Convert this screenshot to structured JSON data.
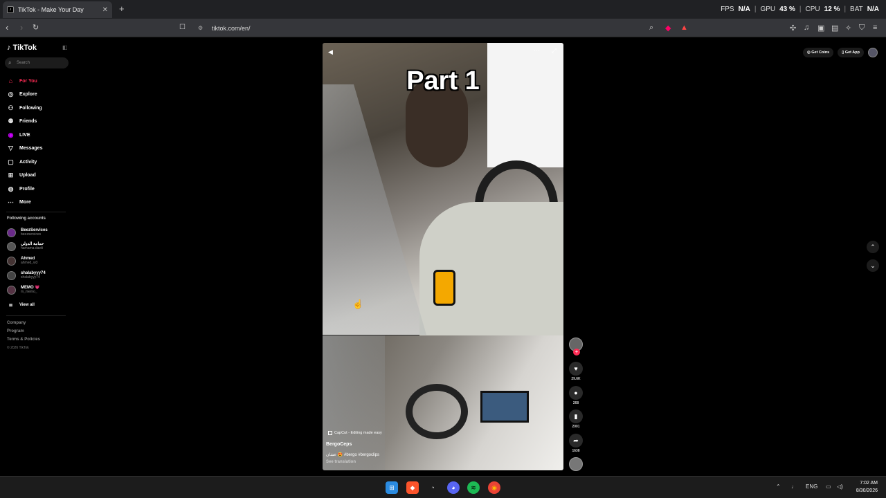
{
  "browser": {
    "tab_title": "TikTok - Make Your Day",
    "tab_close": "✕",
    "new_tab": "+",
    "url": "tiktok.com/en/",
    "perf": {
      "fps_label": "FPS",
      "fps_value": "N/A",
      "gpu_label": "GPU",
      "gpu_value": "43 %",
      "cpu_label": "CPU",
      "cpu_value": "12 %",
      "bat_label": "BAT",
      "bat_value": "N/A"
    }
  },
  "sidebar": {
    "logo": "TikTok",
    "search_placeholder": "Search",
    "nav": [
      {
        "label": "For You",
        "icon": "home-icon"
      },
      {
        "label": "Explore",
        "icon": "compass-icon"
      },
      {
        "label": "Following",
        "icon": "following-icon"
      },
      {
        "label": "Friends",
        "icon": "friends-icon"
      },
      {
        "label": "LIVE",
        "icon": "live-icon"
      },
      {
        "label": "Messages",
        "icon": "messages-icon"
      },
      {
        "label": "Activity",
        "icon": "activity-icon"
      },
      {
        "label": "Upload",
        "icon": "upload-icon"
      },
      {
        "label": "Profile",
        "icon": "profile-icon"
      },
      {
        "label": "More",
        "icon": "more-icon"
      }
    ],
    "following_title": "Following accounts",
    "accounts": [
      {
        "name": "BeezServices",
        "handle": "beezservices"
      },
      {
        "name": "حمامة الدولي",
        "handle": "hamama.dawli"
      },
      {
        "name": "Ahmed",
        "handle": "ahmed_w3"
      },
      {
        "name": "shalabyyy74",
        "handle": "shalabyyy74"
      },
      {
        "name": "MEMO 💗",
        "handle": "m_memo_"
      }
    ],
    "view_all": "View all",
    "footer": [
      "Company",
      "Program",
      "Terms & Policies"
    ],
    "copyright": "© 2026 TikTok"
  },
  "video": {
    "overlay_text": "Part 1",
    "capcut": "CapCut - Editing made easy",
    "username": "BergoCeps",
    "description": "عشان 😍 #bergo #bergoclips",
    "see_translation": "See translation"
  },
  "actions": {
    "likes": "29.6K",
    "comments": "268",
    "saves": "2001",
    "shares": "1638"
  },
  "topright": {
    "get_coins": "Get Coins",
    "get_app": "Get App"
  },
  "taskbar": {
    "lang": "ENG",
    "time": "7:02 AM",
    "date": "8/30/2026"
  }
}
